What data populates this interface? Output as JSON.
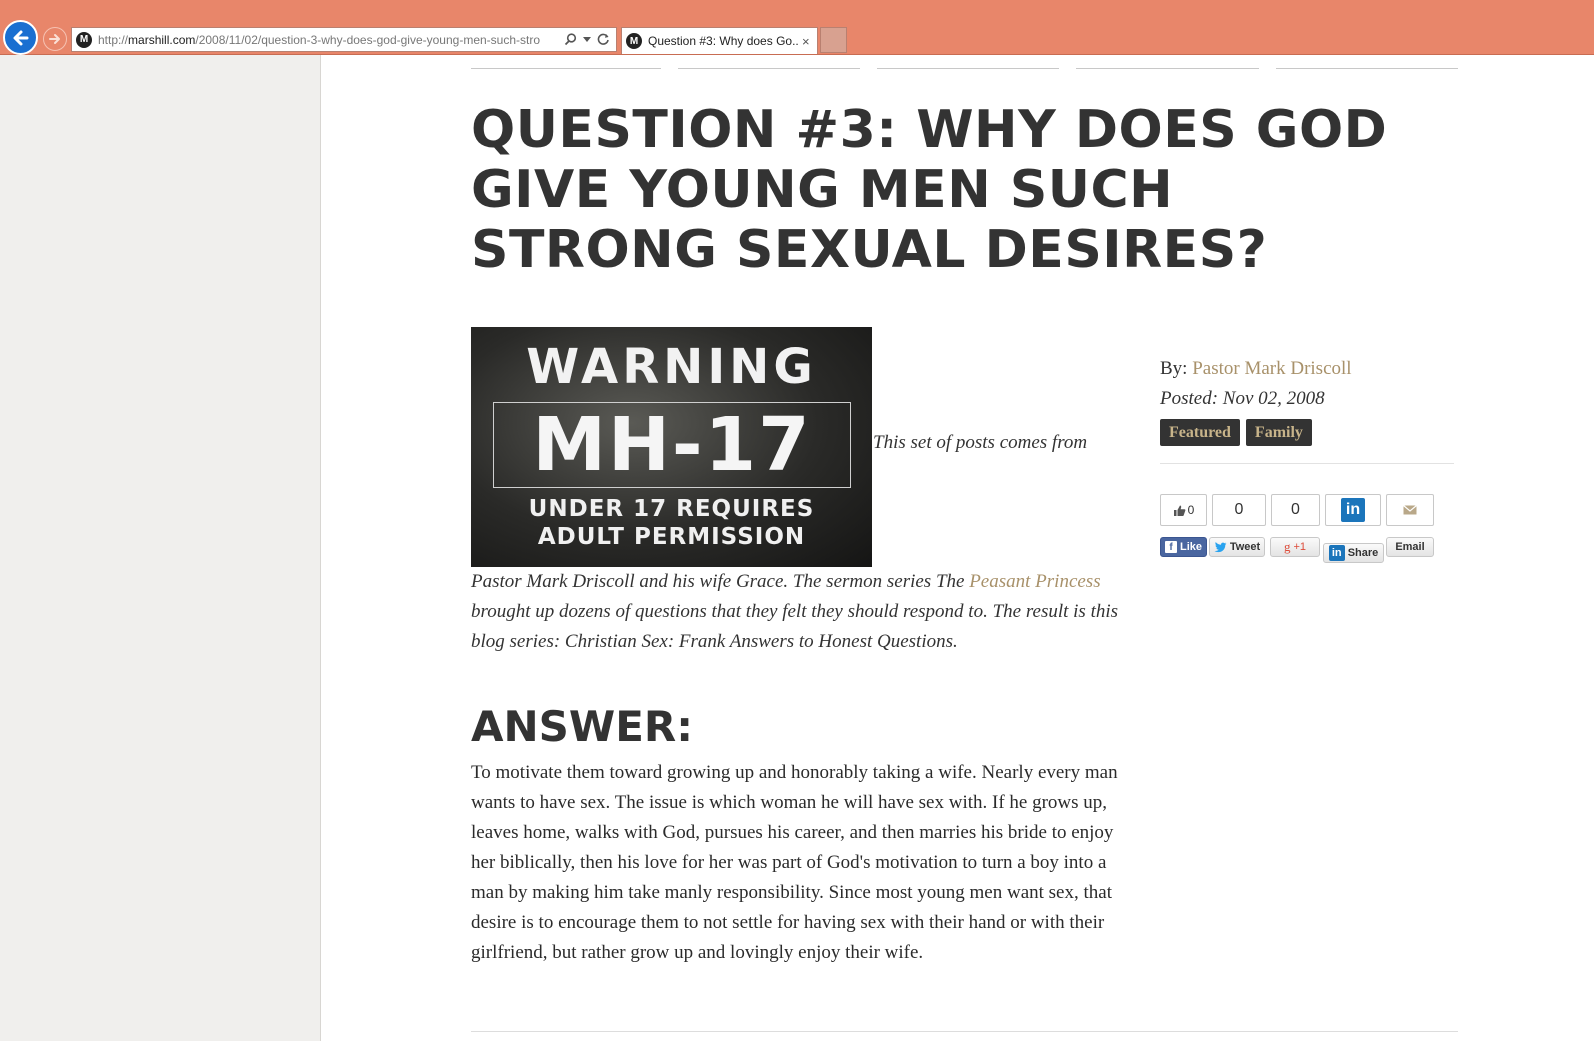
{
  "browser": {
    "url_prefix": "http://",
    "url_domain": "marshill.com",
    "url_path": "/2008/11/02/question-3-why-does-god-give-young-men-such-stro",
    "tab_title": "Question #3: Why does Go...",
    "tab_close": "×",
    "favicon_letter": "M",
    "accent_color": "#e8866a"
  },
  "article": {
    "title": "QUESTION #3: WHY DOES GOD GIVE YOUNG MEN SUCH STRONG SEXUAL DESIRES?",
    "image": {
      "top_text": "WARNING",
      "rating_text": "MH-17",
      "bottom_line1": "UNDER 17 REQUIRES",
      "bottom_line2": "ADULT PERMISSION"
    },
    "intro_first": "This set of posts comes from",
    "intro_part1": "Pastor Mark Driscoll and his wife Grace. The sermon series The ",
    "intro_link": "Peasant Princess",
    "intro_part2": " brought up dozens of questions that they felt they should respond to. The result is this blog series: Christian Sex: Frank Answers to Honest Questions.",
    "answer_heading": "ANSWER:",
    "answer_body": "To motivate them toward growing up and honorably taking a wife. Nearly every man wants to have sex. The issue is which woman he will have sex with. If he grows up, leaves home, walks with God, pursues his career, and then marries his bride to enjoy her biblically, then his love for her was part of God's motivation to turn a boy into a man by making him take manly responsibility. Since most young men want sex, that desire is to encourage them to not settle for having sex with their hand or with their girlfriend, but rather grow up and lovingly enjoy their wife."
  },
  "sidebar": {
    "by_label": "By: ",
    "author": "Pastor Mark Driscoll",
    "posted": "Posted: Nov 02, 2008",
    "tags": [
      "Featured",
      "Family"
    ],
    "link_color": "#a8916a"
  },
  "share": {
    "fb_count": "0",
    "tweet_count": "0",
    "gplus_count": "0",
    "like_label": "Like",
    "tweet_label": "Tweet",
    "gplus_label": "+1",
    "share_label": "Share",
    "email_label": "Email",
    "linkedin_text": "in"
  }
}
